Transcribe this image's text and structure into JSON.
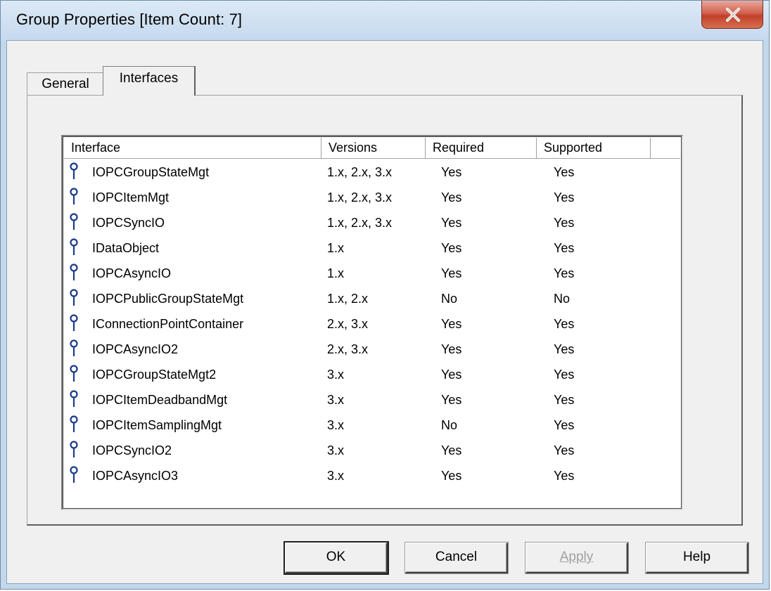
{
  "window": {
    "title": "Group Properties [Item Count: 7]",
    "close_icon": "close-icon"
  },
  "tabs": [
    {
      "label": "General",
      "active": false
    },
    {
      "label": "Interfaces",
      "active": true
    }
  ],
  "list": {
    "columns": [
      "Interface",
      "Versions",
      "Required",
      "Supported"
    ],
    "row_icon": "interface-lollipop-icon",
    "rows": [
      {
        "name": "IOPCGroupStateMgt",
        "versions": "1.x, 2.x, 3.x",
        "required": "Yes",
        "supported": "Yes"
      },
      {
        "name": "IOPCItemMgt",
        "versions": "1.x, 2.x, 3.x",
        "required": "Yes",
        "supported": "Yes"
      },
      {
        "name": "IOPCSyncIO",
        "versions": "1.x, 2.x, 3.x",
        "required": "Yes",
        "supported": "Yes"
      },
      {
        "name": "IDataObject",
        "versions": "1.x",
        "required": "Yes",
        "supported": "Yes"
      },
      {
        "name": "IOPCAsyncIO",
        "versions": "1.x",
        "required": "Yes",
        "supported": "Yes"
      },
      {
        "name": "IOPCPublicGroupStateMgt",
        "versions": "1.x, 2.x",
        "required": "No",
        "supported": "No"
      },
      {
        "name": "IConnectionPointContainer",
        "versions": "2.x, 3.x",
        "required": "Yes",
        "supported": "Yes"
      },
      {
        "name": "IOPCAsyncIO2",
        "versions": "2.x, 3.x",
        "required": "Yes",
        "supported": "Yes"
      },
      {
        "name": "IOPCGroupStateMgt2",
        "versions": "3.x",
        "required": "Yes",
        "supported": "Yes"
      },
      {
        "name": "IOPCItemDeadbandMgt",
        "versions": "3.x",
        "required": "Yes",
        "supported": "Yes"
      },
      {
        "name": "IOPCItemSamplingMgt",
        "versions": "3.x",
        "required": "No",
        "supported": "Yes"
      },
      {
        "name": "IOPCSyncIO2",
        "versions": "3.x",
        "required": "Yes",
        "supported": "Yes"
      },
      {
        "name": "IOPCAsyncIO3",
        "versions": "3.x",
        "required": "Yes",
        "supported": "Yes"
      }
    ]
  },
  "buttons": {
    "ok": "OK",
    "cancel": "Cancel",
    "apply": "Apply",
    "help": "Help"
  },
  "colors": {
    "title_bar": "#c6d9ee",
    "close_button": "#c0412b",
    "icon_color": "#1a3a8a",
    "disabled_text": "#a0a0a0"
  }
}
